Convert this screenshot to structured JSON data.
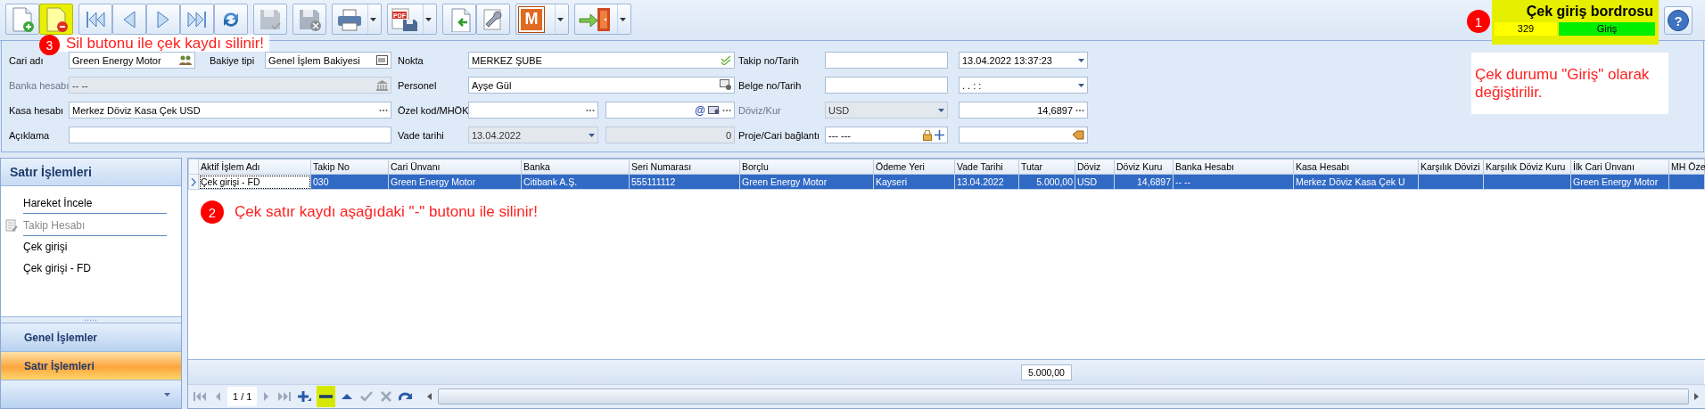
{
  "toolbar": {
    "groups": [
      [
        {
          "kind": "new",
          "disabled": false,
          "dropdown": false,
          "highlighted": false
        },
        {
          "kind": "delete",
          "disabled": false,
          "dropdown": false,
          "highlighted": true
        }
      ],
      [
        {
          "kind": "first",
          "disabled": false,
          "dropdown": false,
          "highlighted": false
        },
        {
          "kind": "prev",
          "disabled": false,
          "dropdown": false,
          "highlighted": false
        },
        {
          "kind": "next",
          "disabled": false,
          "dropdown": false,
          "highlighted": false
        },
        {
          "kind": "last",
          "disabled": false,
          "dropdown": false,
          "highlighted": false
        },
        {
          "kind": "refresh",
          "disabled": false,
          "dropdown": false,
          "highlighted": false
        }
      ],
      [
        {
          "kind": "save",
          "disabled": true,
          "dropdown": false,
          "highlighted": false
        }
      ],
      [
        {
          "kind": "save-cancel",
          "disabled": true,
          "dropdown": false,
          "highlighted": false
        }
      ],
      [
        {
          "kind": "print",
          "disabled": false,
          "dropdown": true,
          "highlighted": false
        }
      ],
      [
        {
          "kind": "pdf",
          "label": "PDF",
          "disabled": false,
          "dropdown": true,
          "highlighted": false
        }
      ],
      [
        {
          "kind": "import",
          "disabled": false,
          "dropdown": false,
          "highlighted": false
        },
        {
          "kind": "tools",
          "disabled": false,
          "dropdown": false,
          "highlighted": false
        }
      ],
      [
        {
          "kind": "letter",
          "label": "M",
          "disabled": false,
          "dropdown": true,
          "highlighted": false
        }
      ],
      [
        {
          "kind": "exit",
          "disabled": false,
          "dropdown": true,
          "highlighted": false
        }
      ]
    ]
  },
  "header": {
    "title": "Çek giriş bordrosu",
    "number": "329",
    "status": "Giriş",
    "highlighted": true
  },
  "help_button": {
    "label": "?"
  },
  "form": {
    "rows": [
      {
        "sections": [
          {
            "label": "Cari adı",
            "disabled": false,
            "fields": [
              {
                "value": "Green Energy Motor",
                "kind": "people",
                "disabled": false
              },
              {
                "label": "Bakiye tipi",
                "value": "Genel İşlem Bakiyesi",
                "kind": "calc",
                "disabled": false
              }
            ]
          },
          {
            "label": "Nokta",
            "disabled": false,
            "fields": [
              {
                "value": "MERKEZ ŞUBE",
                "kind": "check",
                "disabled": false
              }
            ]
          },
          {
            "label": "Takip no/Tarih",
            "disabled": false,
            "fields": [
              {
                "kind": "plain",
                "disabled": false
              }
            ]
          }
        ],
        "side_field": {
          "value": "13.04.2022 13:37:23",
          "kind": "drop",
          "disabled": false
        }
      },
      {
        "sections": [
          {
            "label": "Banka hesabı",
            "disabled": true,
            "fields": [
              {
                "value": "-- --",
                "kind": "bank",
                "disabled": true
              }
            ]
          },
          {
            "label": "Personel",
            "disabled": false,
            "fields": [
              {
                "value": "Ayşe Gül",
                "kind": "person",
                "disabled": false
              }
            ]
          },
          {
            "label": "Belge no/Tarih",
            "disabled": false,
            "fields": [
              {
                "kind": "plain",
                "disabled": false
              }
            ]
          }
        ],
        "side_field": {
          "value": ".  .      :  :",
          "kind": "drop",
          "disabled": false
        }
      },
      {
        "sections": [
          {
            "label": "Kasa hesabı",
            "disabled": false,
            "fields": [
              {
                "value": "Merkez Döviz Kasa Çek USD",
                "kind": "dots",
                "disabled": false
              }
            ]
          },
          {
            "label": "Özel kod/MHÖK",
            "disabled": false,
            "fields": [
              {
                "kind": "dots",
                "disabled": false
              },
              {
                "kind": "mail",
                "symbol": "@",
                "disabled": false
              }
            ]
          },
          {
            "label": "Döviz/Kur",
            "disabled": true,
            "fields": [
              {
                "value": "USD",
                "kind": "drop",
                "disabled": true
              }
            ]
          }
        ],
        "side_field": {
          "value": "14,6897",
          "kind": "dots",
          "disabled": false,
          "numeric": true
        }
      },
      {
        "sections": [
          {
            "label": "Açıklama",
            "disabled": false,
            "fields": [
              {
                "kind": "plain",
                "disabled": false
              }
            ]
          },
          {
            "label": "Vade tarihi",
            "disabled": false,
            "fields": [
              {
                "value": "13.04.2022",
                "kind": "drop",
                "disabled": true
              },
              {
                "value": "0",
                "kind": "plain",
                "disabled": true,
                "numeric": true
              }
            ]
          },
          {
            "label": "Proje/Cari bağlantı",
            "disabled": false,
            "fields": [
              {
                "value": "--- ---",
                "kind": "lock-plus",
                "disabled": false
              }
            ]
          }
        ],
        "side_field": {
          "kind": "tag",
          "disabled": false
        }
      }
    ]
  },
  "sidebar": {
    "title": "Satır İşlemleri",
    "items": [
      {
        "label": "Hareket İncele",
        "disabled": false,
        "separator_after": true
      },
      {
        "label": "Takip Hesabı",
        "disabled": true,
        "separator_after": true
      },
      {
        "label": "Çek girişi",
        "disabled": false,
        "separator_after": false
      },
      {
        "label": "Çek girişi - FD",
        "disabled": false,
        "separator_after": false
      }
    ],
    "nav": [
      {
        "label": "Genel İşlemler",
        "selected": false
      },
      {
        "label": "Satır İşlemleri",
        "selected": true
      },
      {
        "selected": false
      }
    ]
  },
  "grid": {
    "columns": [
      {
        "title": "Aktif İşlem Adı"
      },
      {
        "title": "Takip No"
      },
      {
        "title": "Cari Ünvanı"
      },
      {
        "title": "Banka"
      },
      {
        "title": "Seri Numarası"
      },
      {
        "title": "Borçlu"
      },
      {
        "title": "Ödeme Yeri"
      },
      {
        "title": "Vade Tarihi"
      },
      {
        "title": "Tutar",
        "total": "5.000,00"
      },
      {
        "title": "Döviz"
      },
      {
        "title": "Döviz Kuru"
      },
      {
        "title": "Banka Hesabı"
      },
      {
        "title": "Kasa Hesabı"
      },
      {
        "title": "Karşılık Dövizi"
      },
      {
        "title": "Karşılık Döviz Kuru"
      },
      {
        "title": "İlk Cari Ünvanı"
      },
      {
        "title": "MH Öze"
      }
    ],
    "rows": [
      {
        "selected": true,
        "cells": [
          {
            "text": "Çek girişi - FD"
          },
          {
            "text": "030"
          },
          {
            "text": "Green Energy Motor"
          },
          {
            "text": "Citibank A.Ş."
          },
          {
            "text": "555111112"
          },
          {
            "text": "Green Energy Motor"
          },
          {
            "text": "Kayseri"
          },
          {
            "text": "13.04.2022"
          },
          {
            "text": "5.000,00"
          },
          {
            "text": "USD"
          },
          {
            "text": "14,6897"
          },
          {
            "text": "-- --"
          },
          {
            "text": "Merkez Döviz Kasa Çek U"
          },
          {},
          {},
          {
            "text": "Green Energy Motor"
          },
          {}
        ]
      }
    ],
    "navigator": {
      "page": "1 / 1",
      "buttons": [
        {
          "kind": "first",
          "disabled": true,
          "highlighted": false
        },
        {
          "kind": "prev",
          "disabled": true,
          "highlighted": false
        },
        {
          "kind": "page"
        },
        {
          "kind": "next",
          "disabled": true,
          "highlighted": false
        },
        {
          "kind": "last",
          "disabled": true,
          "highlighted": false
        },
        {
          "kind": "add",
          "disabled": false,
          "highlighted": false
        },
        {
          "kind": "remove",
          "disabled": false,
          "highlighted": true
        },
        {
          "kind": "up",
          "disabled": false,
          "highlighted": false
        },
        {
          "kind": "accept",
          "disabled": true,
          "highlighted": false
        },
        {
          "kind": "cancel",
          "disabled": true,
          "highlighted": false
        },
        {
          "kind": "redo",
          "disabled": false,
          "highlighted": false
        }
      ]
    }
  },
  "annotations": [
    {
      "number": "1",
      "text": "Çek durumu \"Giriş\" olarak değiştirilir."
    },
    {
      "number": "2",
      "text": "Çek satır kaydı aşağıdaki \"-\" butonu ile silinir!"
    },
    {
      "number": "3",
      "text": "Sil butonu ile çek kaydı silinir!"
    }
  ]
}
